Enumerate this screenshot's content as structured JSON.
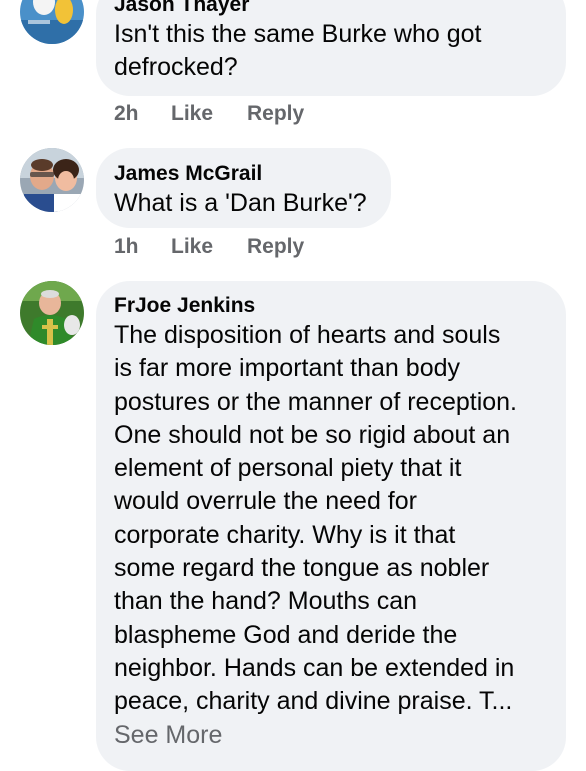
{
  "comments": [
    {
      "author": "Jason Thayer",
      "text": "Isn't this the same Burke who got\ndefrocked?",
      "time": "2h",
      "like_label": "Like",
      "reply_label": "Reply"
    },
    {
      "author": "James McGrail",
      "text": "What is a 'Dan Burke'?",
      "time": "1h",
      "like_label": "Like",
      "reply_label": "Reply"
    },
    {
      "author": "FrJoe Jenkins",
      "text": "The disposition of hearts and souls\nis far more important than body\npostures or the manner of reception.\nOne should not be so rigid about an\nelement of personal piety that it\nwould overrule the need for\ncorporate charity.  Why is it that\nsome regard the tongue as nobler\nthan the hand?  Mouths can\nblaspheme God and deride the\nneighbor.  Hands can be extended in\npeace, charity and divine praise.  T...",
      "see_more_label": "See More"
    }
  ],
  "colors": {
    "bubble": "#f0f2f5",
    "text": "#050505",
    "secondary": "#65676b"
  }
}
